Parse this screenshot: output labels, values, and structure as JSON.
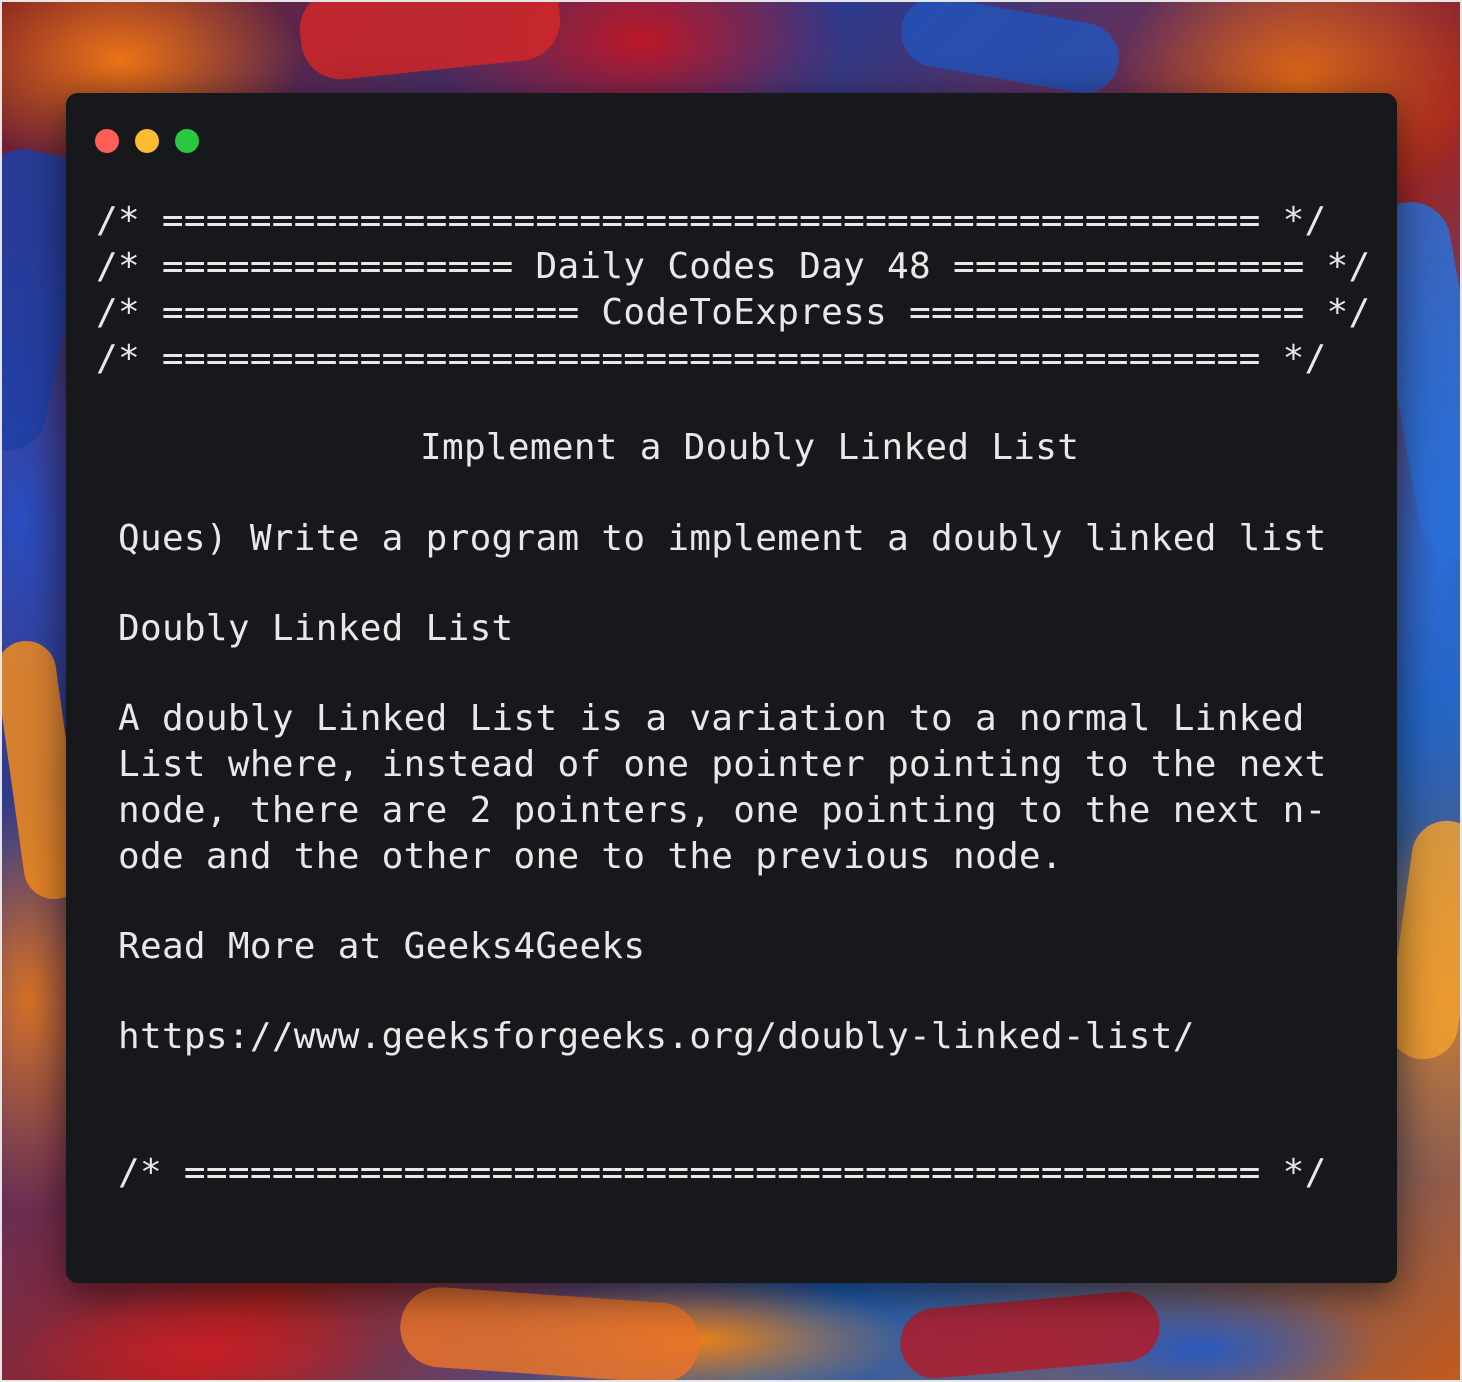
{
  "window": {
    "traffic_lights": {
      "close_color": "#ff5f57",
      "minimize_color": "#febc2e",
      "maximize_color": "#28c840"
    }
  },
  "code": {
    "header_border_top": "/* ================================================== */",
    "header_title": "/* ================ Daily Codes Day 48 ================ */",
    "header_subtitle": "/* =================== CodeToExpress ================== */",
    "header_border_bottom": "/* ================================================== */",
    "heading": "Implement a Doubly Linked List",
    "question": "Ques) Write a program to implement a doubly linked list",
    "section_title": "Doubly Linked List",
    "description_lines": [
      "A doubly Linked List is a variation to a normal Linked",
      "List where, instead of one pointer pointing to the next",
      "node, there are 2 pointers, one pointing to the next n-",
      "ode and the other one to the previous node."
    ],
    "read_more": "Read More at Geeks4Geeks",
    "link": "https://www.geeksforgeeks.org/doubly-linked-list/",
    "footer_border": "/* ================================================= */"
  }
}
